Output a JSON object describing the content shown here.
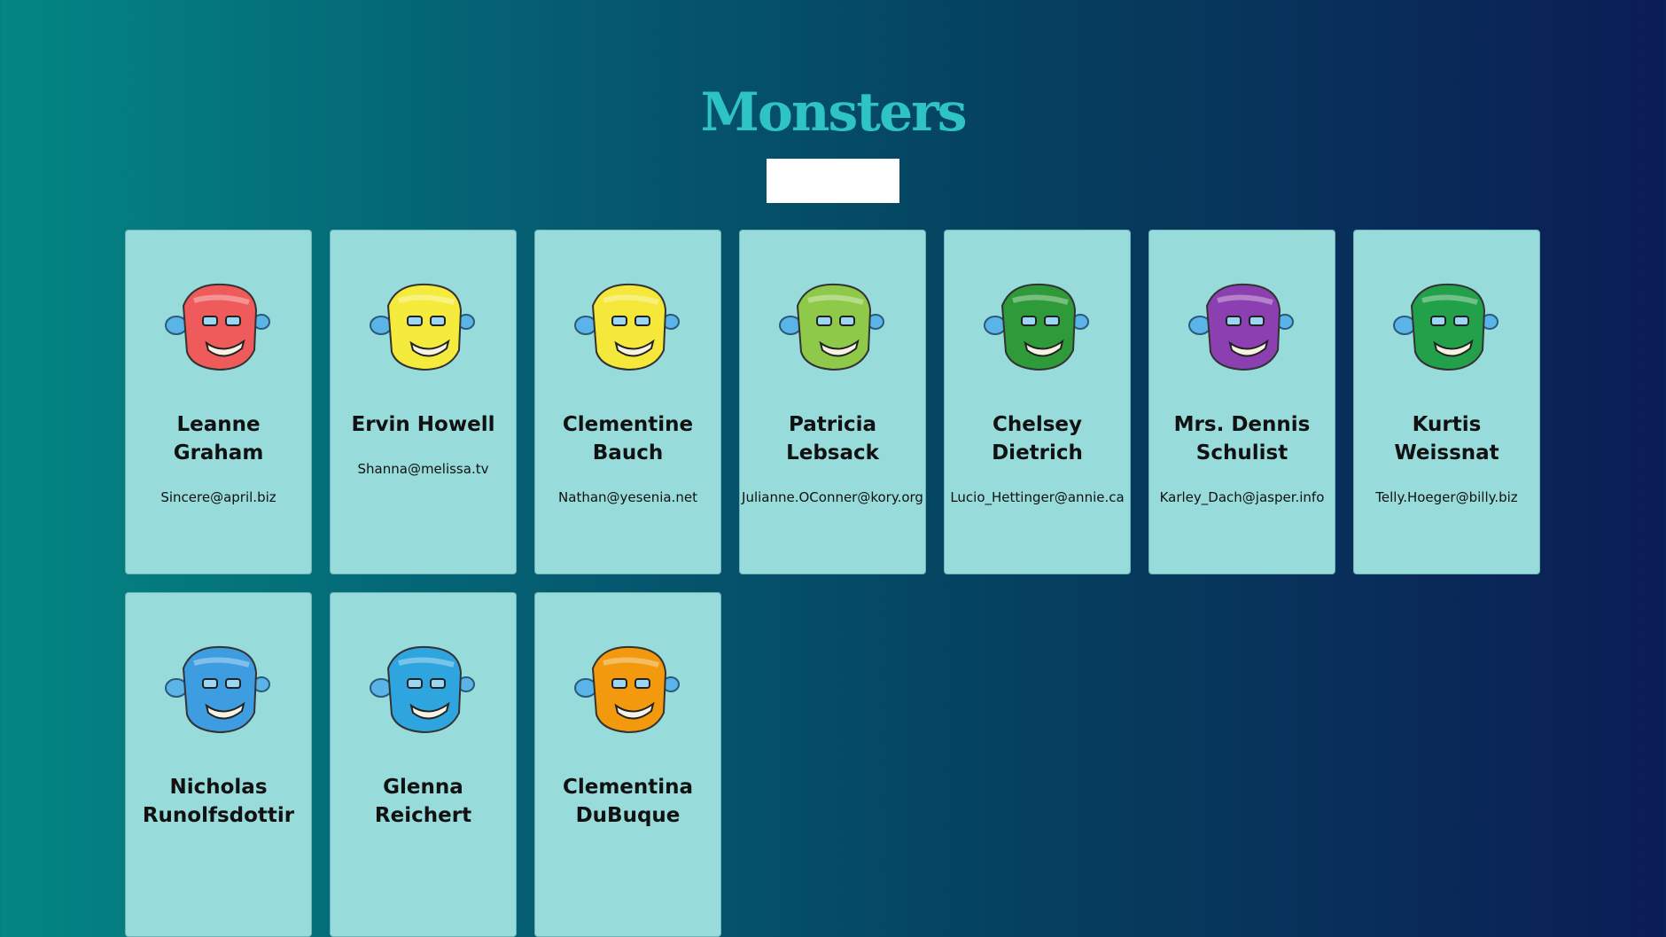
{
  "app": {
    "title": "Monsters"
  },
  "search": {
    "value": "",
    "placeholder": ""
  },
  "monsters": [
    {
      "name": "Leanne Graham",
      "email": "Sincere@april.biz",
      "color": "#ef5a5a",
      "icon": "robot-monster-avatar"
    },
    {
      "name": "Ervin Howell",
      "email": "Shanna@melissa.tv",
      "color": "#f5eb3c",
      "icon": "robot-monster-avatar"
    },
    {
      "name": "Clementine Bauch",
      "email": "Nathan@yesenia.net",
      "color": "#f5e83a",
      "icon": "robot-monster-avatar"
    },
    {
      "name": "Patricia Lebsack",
      "email": "Julianne.OConner@kory.org",
      "color": "#8fc94a",
      "icon": "robot-monster-avatar"
    },
    {
      "name": "Chelsey Dietrich",
      "email": "Lucio_Hettinger@annie.ca",
      "color": "#2e9a3a",
      "icon": "robot-monster-avatar"
    },
    {
      "name": "Mrs. Dennis Schulist",
      "email": "Karley_Dach@jasper.info",
      "color": "#8c3fb0",
      "icon": "robot-monster-avatar"
    },
    {
      "name": "Kurtis Weissnat",
      "email": "Telly.Hoeger@billy.biz",
      "color": "#22a04a",
      "icon": "robot-monster-avatar"
    },
    {
      "name": "Nicholas Runolfsdottir",
      "email": "",
      "color": "#3d9de0",
      "icon": "robot-monster-avatar"
    },
    {
      "name": "Glenna Reichert",
      "email": "",
      "color": "#2fa5e0",
      "icon": "robot-monster-avatar"
    },
    {
      "name": "Clementina DuBuque",
      "email": "",
      "color": "#f2990e",
      "icon": "robot-monster-avatar"
    }
  ]
}
